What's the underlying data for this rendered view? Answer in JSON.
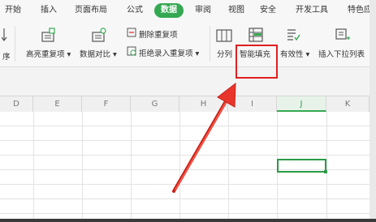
{
  "menu": {
    "tabs": [
      {
        "label": "开始",
        "active": false
      },
      {
        "label": "插入",
        "active": false
      },
      {
        "label": "页面布局",
        "active": false
      },
      {
        "label": "公式",
        "active": false
      },
      {
        "label": "数据",
        "active": true
      },
      {
        "label": "审阅",
        "active": false
      },
      {
        "label": "视图",
        "active": false
      },
      {
        "label": "安全",
        "active": false
      },
      {
        "label": "开发工具",
        "active": false
      },
      {
        "label": "特色应",
        "active": false
      }
    ]
  },
  "ribbon": {
    "sort_label": "序",
    "highlight_duplicates_label": "高亮重复项 ▾",
    "compare_data_label": "数据对比 ▾",
    "remove_duplicates_label": "删除重复项",
    "reject_duplicates_label": "拒绝录入重复项 ▾",
    "split_label": "分列",
    "smart_fill_label": "智能填充",
    "validity_label": "有效性 ▾",
    "dropdown_list_label": "插入下拉列表"
  },
  "sheet": {
    "columns": [
      "D",
      "E",
      "F",
      "G",
      "H",
      "I",
      "J",
      "K"
    ],
    "selected_column": "J",
    "selected_cell": "J"
  },
  "colors": {
    "accent_green": "#35a852",
    "highlight_red": "#e01f1f",
    "arrow_red": "#e8362c"
  }
}
